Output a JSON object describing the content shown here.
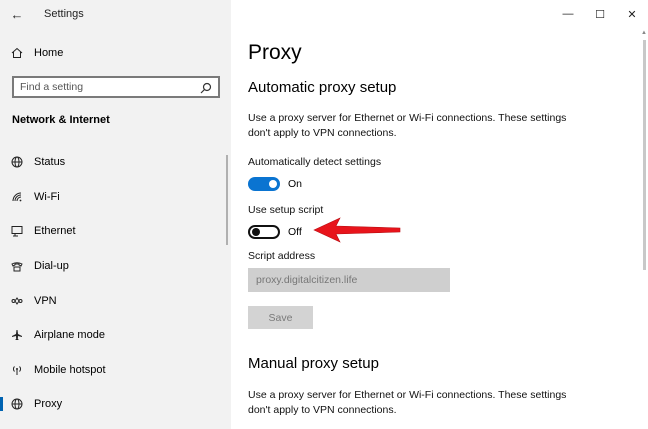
{
  "window": {
    "title": "Settings",
    "controls": {
      "minimize": "—",
      "maximize": "☐",
      "close": "✕"
    }
  },
  "sidebar": {
    "back_glyph": "←",
    "home_label": "Home",
    "search_placeholder": "Find a setting",
    "section_heading": "Network & Internet",
    "items": [
      {
        "label": "Status",
        "icon": "status-globe-icon"
      },
      {
        "label": "Wi-Fi",
        "icon": "wifi-icon"
      },
      {
        "label": "Ethernet",
        "icon": "ethernet-icon"
      },
      {
        "label": "Dial-up",
        "icon": "dialup-icon"
      },
      {
        "label": "VPN",
        "icon": "vpn-icon"
      },
      {
        "label": "Airplane mode",
        "icon": "airplane-icon"
      },
      {
        "label": "Mobile hotspot",
        "icon": "hotspot-icon"
      },
      {
        "label": "Proxy",
        "icon": "proxy-globe-icon",
        "active": true
      }
    ]
  },
  "main": {
    "page_title": "Proxy",
    "auto": {
      "heading": "Automatic proxy setup",
      "description": "Use a proxy server for Ethernet or Wi-Fi connections. These settings don't apply to VPN connections.",
      "detect_label": "Automatically detect settings",
      "detect_state": "On",
      "script_label": "Use setup script",
      "script_state": "Off",
      "address_label": "Script address",
      "address_value": "proxy.digitalcitizen.life",
      "save_label": "Save"
    },
    "manual": {
      "heading": "Manual proxy setup",
      "description": "Use a proxy server for Ethernet or Wi-Fi connections. These settings don't apply to VPN connections."
    }
  },
  "colors": {
    "accent": "#0a74d1",
    "annotation_arrow": "#e8141b"
  }
}
